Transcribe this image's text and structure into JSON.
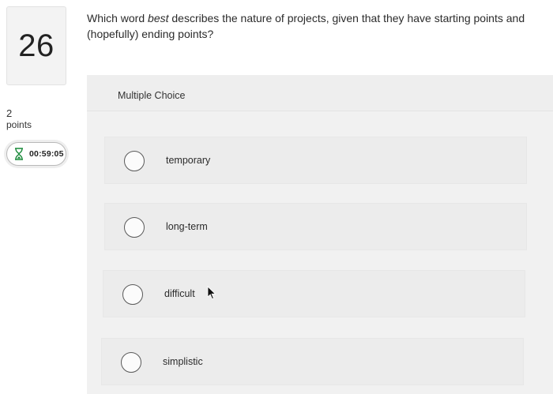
{
  "question": {
    "number": "26",
    "points_value": "2",
    "points_label": "points",
    "timer": "00:59:05",
    "text_before": "Which word ",
    "text_emphasis": "best",
    "text_after": " describes the nature of projects, given that they have starting points and (hopefully) ending points?"
  },
  "answer_panel": {
    "type_label": "Multiple Choice",
    "choices": [
      {
        "label": "temporary"
      },
      {
        "label": "long-term"
      },
      {
        "label": "difficult"
      },
      {
        "label": "simplistic"
      }
    ]
  },
  "icons": {
    "timer": "hourglass-icon",
    "choice_selector": "radio-circle-icon",
    "pointer": "mouse-cursor-icon"
  },
  "colors": {
    "panel_background": "#f1f1f1",
    "choice_background": "#ececec",
    "timer_icon": "#1a8a3a",
    "text": "#2b2b2b"
  }
}
